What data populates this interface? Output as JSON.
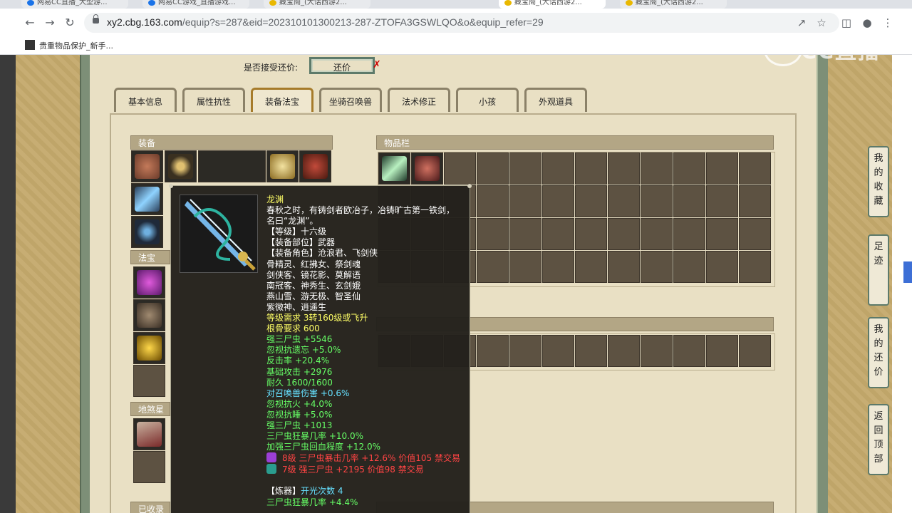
{
  "browser": {
    "tabs": [
      {
        "title": "网易CC直播_大型游...",
        "active": false,
        "color": "#1a73e8"
      },
      {
        "title": "网易CC游戏_直播游戏...",
        "active": false,
        "color": "#1a73e8"
      },
      {
        "title": "藏宝阁_(大话西游2...",
        "active": false,
        "color": "#e9b800"
      },
      {
        "title": "藏宝阁_(大话西游2...",
        "active": true,
        "color": "#e9b800"
      },
      {
        "title": "藏宝阁_(大话西游2...",
        "active": false,
        "color": "#e9b800"
      }
    ],
    "url_host": "xy2.cbg.163.com",
    "url_path": "/equip?s=287&eid=202310101300213-287-ZTOFA3GSWLQO&o&equip_refer=29",
    "bookmark": "贵重物品保护_新手..."
  },
  "offer": {
    "label": "是否接受还价:",
    "button": "还价",
    "mark": "✗"
  },
  "tabs": [
    "基本信息",
    "属性抗性",
    "装备法宝",
    "坐骑召唤兽",
    "法术修正",
    "小孩",
    "外观道具"
  ],
  "sections": {
    "equipment": "装备",
    "inventory": "物品栏",
    "treasure": "法宝",
    "star": "地煞星",
    "collected": "已收录"
  },
  "tooltip": {
    "lines": [
      {
        "text": "龙渊",
        "color": "#ffff66"
      },
      {
        "text": "春秋之时，有铸剑者欧冶子，冶铸旷古第一铁剑，",
        "color": "#ffffff"
      },
      {
        "text": "名曰“龙渊”。",
        "color": "#ffffff"
      },
      {
        "text": "【等级】十六级",
        "color": "#ffffff"
      },
      {
        "text": "【装备部位】武器",
        "color": "#ffffff"
      },
      {
        "text": "【装备角色】沧浪君、飞剑侠",
        "color": "#ffffff"
      },
      {
        "text": "骨精灵、红拂女、祭剑魂",
        "color": "#ffffff"
      },
      {
        "text": "剑侠客、镜花影、莫解语",
        "color": "#ffffff"
      },
      {
        "text": "南冠客、神秀生、玄剑娥",
        "color": "#ffffff"
      },
      {
        "text": "燕山雪、游无极、智圣仙",
        "color": "#ffffff"
      },
      {
        "text": "紫微神、逍遥生",
        "color": "#ffffff"
      },
      {
        "text": "等级需求 3转160级或飞升",
        "color": "#ffff66"
      },
      {
        "text": "根骨要求 600",
        "color": "#ffff66"
      },
      {
        "text": "强三尸虫 +5546",
        "color": "#66ff66"
      },
      {
        "text": "忽视抗遗忘 +5.0%",
        "color": "#66ff66"
      },
      {
        "text": "反击率 +20.4%",
        "color": "#66ff66"
      },
      {
        "text": "基础攻击 +2976",
        "color": "#66ff66"
      },
      {
        "text": "耐久 1600/1600",
        "color": "#66ff66"
      },
      {
        "text": "对召唤兽伤害 +0.6%",
        "color": "#66e0ff"
      },
      {
        "text": "忽视抗火 +4.0%",
        "color": "#66ff66"
      },
      {
        "text": "忽视抗睡 +5.0%",
        "color": "#66ff66"
      },
      {
        "text": "强三尸虫 +1013",
        "color": "#66ff66"
      },
      {
        "text": "三尸虫狂暴几率 +10.0%",
        "color": "#66ff66"
      },
      {
        "text": "加强三尸虫回血程度 +12.0%",
        "color": "#66ff66"
      }
    ],
    "gems": [
      {
        "text": "8级 三尸虫暴击几率 +12.6% 价值105 禁交易",
        "color": "#ff4444",
        "gem_color": "#9b3fd6"
      },
      {
        "text": "7级 强三尸虫 +2195 价值98 禁交易",
        "color": "#ff4444",
        "gem_color": "#2a9d8f"
      }
    ],
    "refine_label": "【炼器】",
    "refine_value": "开光次数 4",
    "refine_extra": "三尸虫狂暴几率 +4.4%"
  },
  "side_buttons": [
    "我的收藏",
    "足迹",
    "我的还价",
    "返回顶部"
  ],
  "watermark": "CC直播"
}
